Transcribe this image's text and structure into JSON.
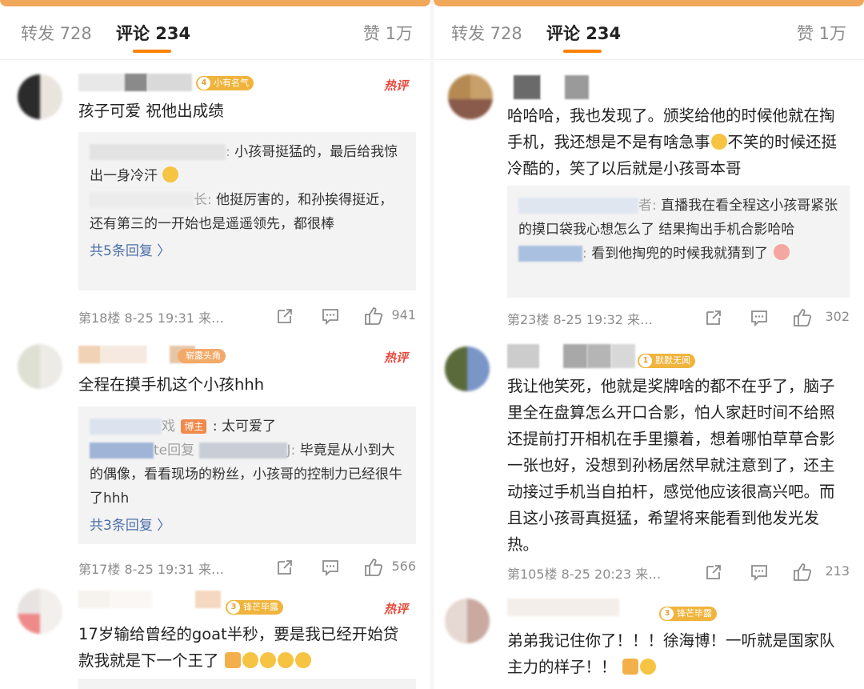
{
  "tabs": {
    "forward": "转发 728",
    "comment": "评论 234",
    "like": "赞 1万"
  },
  "colors": {
    "accent": "#ff8200",
    "hot": "#e8483b",
    "link": "#4b6ea8"
  },
  "left": [
    {
      "badge": "小有名气",
      "badge_level": "4",
      "badge_color": "#f0b43c",
      "hot": "热评",
      "text": "孩子可爱 祝他出成绩",
      "replies": [
        {
          "author": ":",
          "text": "小孩哥挺猛的，最后给我惊出一身冷汗"
        },
        {
          "author": "长:",
          "text": "他挺厉害的，和孙挨得挺近，还有第三的一开始也是遥遥领先，都很棒"
        }
      ],
      "more": "共5条回复 〉",
      "meta": "第18楼 8-25 19:31 来…",
      "likes": "941"
    },
    {
      "badge": "崭露头角",
      "badge_level": "",
      "badge_color": "#f3a968",
      "hot": "热评",
      "text": "全程在摸手机这个小孩hhh",
      "replies": [
        {
          "author": "戏",
          "tag": "博主",
          "text": ": 太可爱了"
        },
        {
          "author": "te回复",
          "author2": "J:",
          "text": "毕竟是从小到大的偶像，看看现场的粉丝，小孩哥的控制力已经很牛了hhh"
        }
      ],
      "more": "共3条回复 〉",
      "meta": "第17楼 8-25 19:31 来…",
      "likes": "566"
    },
    {
      "badge": "锋芒毕露",
      "badge_level": "3",
      "badge_color": "#f0b43c",
      "hot": "热评",
      "text": "17岁输给曾经的goat半秒，要是我已经开始贷款我就是下一个王了"
    }
  ],
  "right": [
    {
      "text": "哈哈哈，我也发现了。颁奖给他的时候他就在掏手机，我还想是不是有啥急事",
      "text_after": "不笑的时候还挺冷酷的，笑了以后就是小孩哥本哥",
      "replies": [
        {
          "author": "者:",
          "text": "直播我在看全程这小孩哥紧张的摸口袋我心想怎么了 结果掏出手机合影哈哈"
        },
        {
          "author": ":",
          "text": "看到他掏兜的时候我就猜到了"
        }
      ],
      "meta": "第23楼 8-25 19:32 来…",
      "likes": "302"
    },
    {
      "badge": "默默无闻",
      "badge_level": "1",
      "badge_color": "#f0b43c",
      "text": "我让他笑死，他就是奖牌啥的都不在乎了，脑子里全在盘算怎么开口合影，怕人家赶时间不给照还提前打开相机在手里攥着，想着哪怕草草合影一张也好，没想到孙杨居然早就注意到了，还主动接过手机当自拍杆，感觉他应该很高兴吧。而且这小孩哥真挺猛，希望将来能看到他发光发热。",
      "meta": "第105楼 8-25 20:23 来…",
      "likes": "213"
    },
    {
      "badge": "锋芒毕露",
      "badge_level": "3",
      "badge_color": "#f0b43c",
      "text": "弟弟我记住你了！！！徐海博！一听就是国家队主力的样子！！"
    }
  ]
}
